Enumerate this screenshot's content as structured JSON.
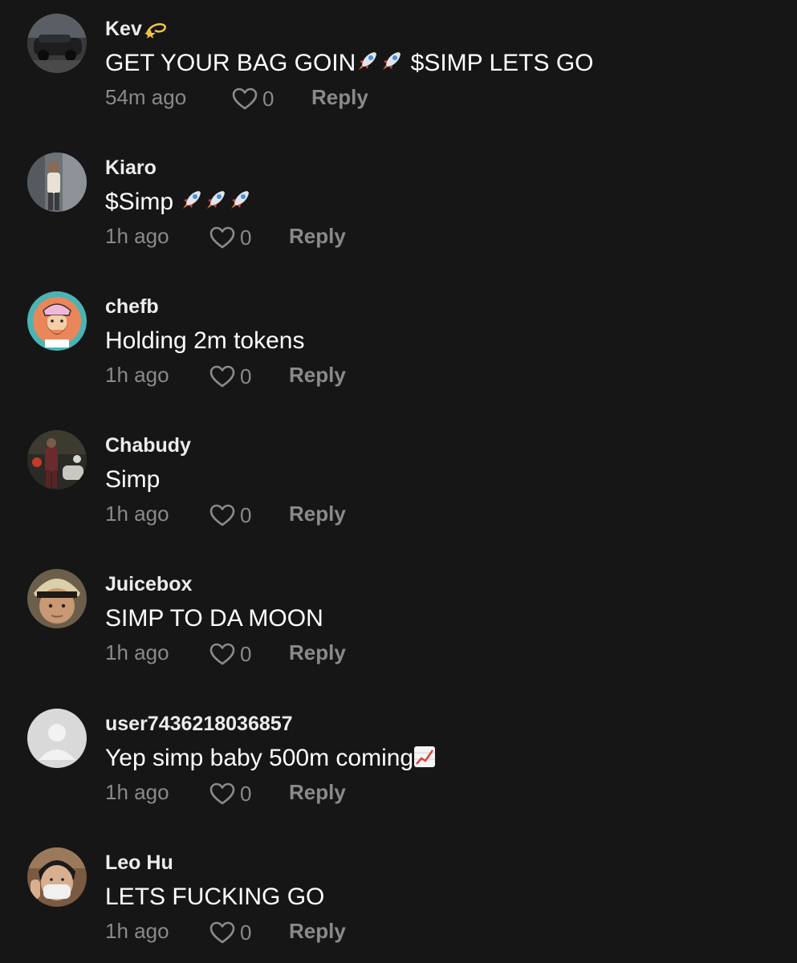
{
  "comments": [
    {
      "username": "Kev",
      "username_icon": "dizzy-icon",
      "text": "GET YOUR BAG GOIN",
      "text_icons": [
        "rocket-icon",
        "rocket-icon"
      ],
      "text_after": " $SIMP LETS GO",
      "time": "54m ago",
      "likes": "0",
      "reply_label": "Reply",
      "avatar": "car-photo"
    },
    {
      "username": "Kiaro",
      "text": "$Simp ",
      "text_icons": [
        "rocket-icon",
        "rocket-icon",
        "rocket-icon"
      ],
      "time": "1h ago",
      "likes": "0",
      "reply_label": "Reply",
      "avatar": "person-photo"
    },
    {
      "username": "chefb",
      "text": "Holding 2m tokens",
      "time": "1h ago",
      "likes": "0",
      "reply_label": "Reply",
      "avatar": "cartoon-chef"
    },
    {
      "username": "Chabudy",
      "text": "Simp",
      "time": "1h ago",
      "likes": "0",
      "reply_label": "Reply",
      "avatar": "person-suit-photo"
    },
    {
      "username": "Juicebox",
      "text": "SIMP TO DA MOON",
      "time": "1h ago",
      "likes": "0",
      "reply_label": "Reply",
      "avatar": "selfie-photo"
    },
    {
      "username": "user7436218036857",
      "text": "Yep simp baby 500m coming",
      "text_icons": [
        "chart-increasing-icon"
      ],
      "time": "1h ago",
      "likes": "0",
      "reply_label": "Reply",
      "avatar": "default-avatar"
    },
    {
      "username": "Leo Hu",
      "text": "LETS FUCKING GO",
      "time": "1h ago",
      "likes": "0",
      "reply_label": "Reply",
      "avatar": "masked-person-photo"
    }
  ],
  "colors": {
    "background": "#161616",
    "username": "#ececec",
    "text": "#ffffff",
    "meta": "#8a8a8a"
  }
}
